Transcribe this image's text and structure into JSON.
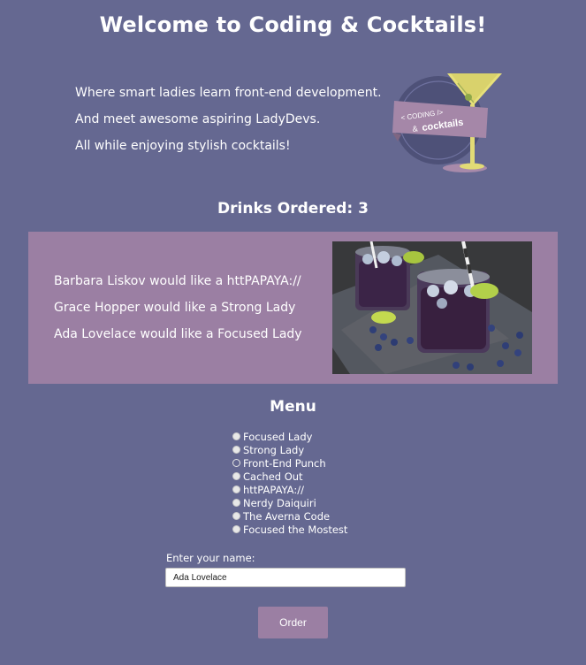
{
  "header": {
    "title": "Welcome to Coding & Cocktails!"
  },
  "intro": {
    "lines": [
      "Where smart ladies learn front-end development.",
      "And meet awesome aspiring LadyDevs.",
      "All while enjoying stylish cocktails!"
    ]
  },
  "logo": {
    "banner_line1": "< CODING />",
    "banner_line2_prefix": "&",
    "banner_line2_word": "cocktails"
  },
  "drinks": {
    "label": "Drinks Ordered: 3"
  },
  "orders": [
    "Barbara Liskov would like a httPAPAYA://",
    "Grace Hopper would like a Strong Lady",
    "Ada Lovelace would like a Focused Lady"
  ],
  "menu": {
    "heading": "Menu",
    "items": [
      {
        "label": "Focused Lady",
        "selected": false
      },
      {
        "label": "Strong Lady",
        "selected": false
      },
      {
        "label": "Front-End Punch",
        "selected": true
      },
      {
        "label": "Cached Out",
        "selected": false
      },
      {
        "label": "httPAPAYA://",
        "selected": false
      },
      {
        "label": "Nerdy Daiquiri",
        "selected": false
      },
      {
        "label": "The Averna Code",
        "selected": false
      },
      {
        "label": "Focused the Mostest",
        "selected": false
      }
    ]
  },
  "form": {
    "name_label": "Enter your name:",
    "name_value": "Ada Lovelace",
    "order_button": "Order"
  },
  "colors": {
    "background": "#656891",
    "panel": "#9b7fa3",
    "text": "#ffffff"
  }
}
